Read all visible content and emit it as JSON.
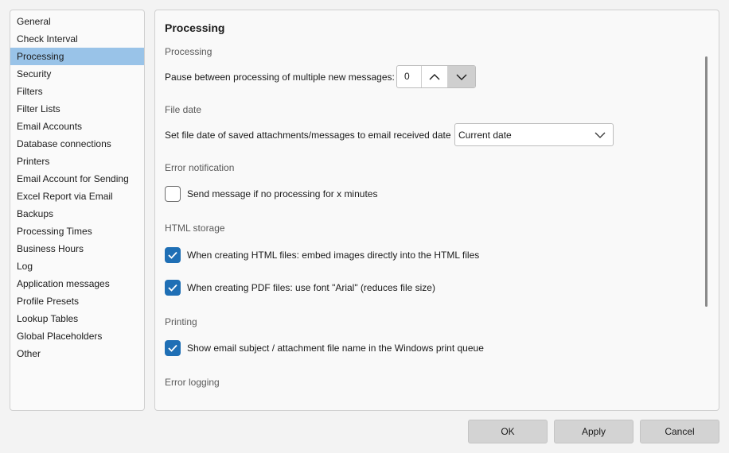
{
  "sidebar": {
    "items": [
      {
        "label": "General"
      },
      {
        "label": "Check Interval"
      },
      {
        "label": "Processing",
        "selected": true
      },
      {
        "label": "Security"
      },
      {
        "label": "Filters"
      },
      {
        "label": "Filter Lists"
      },
      {
        "label": "Email Accounts"
      },
      {
        "label": "Database connections"
      },
      {
        "label": "Printers"
      },
      {
        "label": "Email Account for Sending"
      },
      {
        "label": "Excel Report via Email"
      },
      {
        "label": "Backups"
      },
      {
        "label": "Processing Times"
      },
      {
        "label": "Business Hours"
      },
      {
        "label": "Log"
      },
      {
        "label": "Application messages"
      },
      {
        "label": "Profile Presets"
      },
      {
        "label": "Lookup Tables"
      },
      {
        "label": "Global Placeholders"
      },
      {
        "label": "Other"
      }
    ]
  },
  "main": {
    "title": "Processing",
    "processing": {
      "heading": "Processing",
      "pause_label": "Pause between processing of multiple new messages:",
      "pause_value": "0",
      "up_icon": "chevron-up-icon",
      "down_icon": "chevron-down-icon"
    },
    "file_date": {
      "heading": "File date",
      "label": "Set file date of saved attachments/messages to email received date",
      "selected": "Current date"
    },
    "error_notification": {
      "heading": "Error notification",
      "checkbox_label": "Send message if no processing for x minutes",
      "checked": false
    },
    "html_storage": {
      "heading": "HTML storage",
      "embed_label": "When creating HTML files: embed images directly into the HTML files",
      "embed_checked": true,
      "pdf_label": "When creating PDF files: use font \"Arial\" (reduces file size)",
      "pdf_checked": true
    },
    "printing": {
      "heading": "Printing",
      "label": "Show email subject / attachment file name in the Windows print queue",
      "checked": true
    },
    "error_logging": {
      "heading": "Error logging"
    }
  },
  "footer": {
    "ok": "OK",
    "apply": "Apply",
    "cancel": "Cancel"
  },
  "colors": {
    "selection": "#99c3e8",
    "checkbox_accent": "#1f6fb5",
    "button_bg": "#d3d3d3"
  }
}
